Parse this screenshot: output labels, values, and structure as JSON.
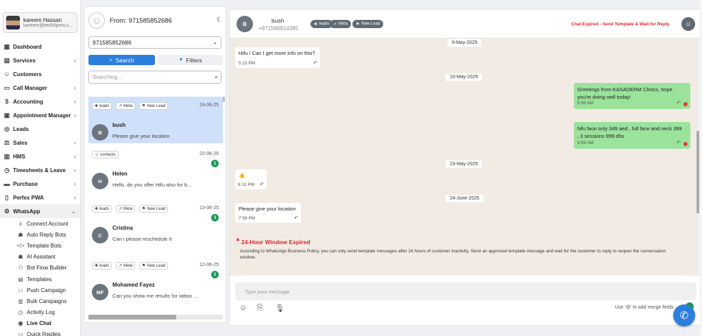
{
  "user": {
    "name": "kareem Hassan",
    "email": "kareem@tech9pros.c..."
  },
  "nav": [
    {
      "label": "Dashboard",
      "icon": "dashboard-icon",
      "glyph": "▦",
      "chevron": false
    },
    {
      "label": "Services",
      "icon": "services-icon",
      "glyph": "▤",
      "chevron": true
    },
    {
      "label": "Customers",
      "icon": "customers-icon",
      "glyph": "☺",
      "chevron": false
    },
    {
      "label": "Call Manager",
      "icon": "call-manager-icon",
      "glyph": "▭",
      "chevron": true
    },
    {
      "label": "Accounting",
      "icon": "accounting-icon",
      "glyph": "$",
      "chevron": true
    },
    {
      "label": "Appointment Manager",
      "icon": "appointment-icon",
      "glyph": "▣",
      "chevron": true
    },
    {
      "label": "Leads",
      "icon": "leads-icon",
      "glyph": "◎",
      "chevron": false
    },
    {
      "label": "Sales",
      "icon": "sales-icon",
      "glyph": "⚖",
      "chevron": true
    },
    {
      "label": "HMS",
      "icon": "hms-icon",
      "glyph": "▥",
      "chevron": true
    },
    {
      "label": "Timesheets & Leave",
      "icon": "timesheets-icon",
      "glyph": "◷",
      "chevron": true
    },
    {
      "label": "Purchase",
      "icon": "purchase-icon",
      "glyph": "▬",
      "chevron": true
    },
    {
      "label": "Perfex PWA",
      "icon": "pwa-icon",
      "glyph": "▯",
      "chevron": true
    },
    {
      "label": "WhatsApp",
      "icon": "whatsapp-icon",
      "glyph": "⚙",
      "chevron": true,
      "expanded": true
    }
  ],
  "subnav": [
    {
      "label": "Connect Account",
      "icon": "plug-icon",
      "glyph": "⏚"
    },
    {
      "label": "Auto Reply Bots",
      "icon": "robot-icon",
      "glyph": "☗"
    },
    {
      "label": "Template Bots",
      "icon": "code-icon",
      "glyph": "</>"
    },
    {
      "label": "AI Assistant",
      "icon": "ai-robot-icon",
      "glyph": "☗"
    },
    {
      "label": "Bot Flow Builder",
      "icon": "flow-icon",
      "glyph": "⚇"
    },
    {
      "label": "Templates",
      "icon": "templates-icon",
      "glyph": "▤"
    },
    {
      "label": "Push Campaign",
      "icon": "push-icon",
      "glyph": "▭"
    },
    {
      "label": "Bulk Campaigns",
      "icon": "bulk-icon",
      "glyph": "▥"
    },
    {
      "label": "Activity Log",
      "icon": "history-icon",
      "glyph": "◷"
    },
    {
      "label": "Live Chat",
      "icon": "chat-bubbles-icon",
      "glyph": "◉",
      "current": true
    },
    {
      "label": "Quick Replies",
      "icon": "quick-reply-icon",
      "glyph": "▭"
    }
  ],
  "contacts_panel": {
    "from_label": "From: 971585852686",
    "selected_number": "971585852686",
    "search_label": "Search",
    "filters_label": "Filters",
    "search_placeholder": "Searching..."
  },
  "chats": [
    {
      "tags": [
        "leads",
        "Meta",
        "New Lead"
      ],
      "date": "24-06-25",
      "initial": "B",
      "name": "bush",
      "message": "Please give your location",
      "unread": "",
      "selected": true
    },
    {
      "tags": [
        "contacts"
      ],
      "date": "22-06-25",
      "initial": "H",
      "name": "Helen",
      "message": "Hello, do you offer Hifu also for b...",
      "unread": "1",
      "selected": false
    },
    {
      "tags": [
        "leads",
        "Meta",
        "New Lead"
      ],
      "date": "13-06-25",
      "initial": "C",
      "name": "Cristina",
      "message": "Can i please reschedule it",
      "unread": "3",
      "selected": false
    },
    {
      "tags": [
        "leads",
        "Meta",
        "New Lead"
      ],
      "date": "12-06-25",
      "initial": "MF",
      "name": "Mohamed Fayez",
      "message": "Can you show me results for tattoo ...",
      "unread": "2",
      "selected": false
    }
  ],
  "conversation": {
    "contact_initial": "B",
    "contact_name": "bush",
    "contact_phone": "+971566914385",
    "header_tags": [
      "leads",
      "Meta",
      "New Lead"
    ],
    "expired_notice": "Chat Expired - Send Template & Wait for Reply",
    "dates": [
      "9-May-2025",
      "10-May-2025",
      "23-May-2025",
      "24-June-2025"
    ],
    "messages": [
      {
        "dir": "in",
        "text": "Hifu ! Can I get more info on this?",
        "time": "5:23 PM"
      },
      {
        "dir": "out",
        "lines": [
          "Greetings from KASADERM Clinics, hope",
          "you're doing well today!"
        ],
        "time": "9:58 AM"
      },
      {
        "dir": "out",
        "lines": [
          "hifu face only 349 aed , full face and neck 399",
          ", 3 sessions 999 dhs"
        ],
        "time": "9:59 AM"
      },
      {
        "dir": "in",
        "text": "👍",
        "time": "6:13 PM"
      },
      {
        "dir": "in",
        "text": "Please give your location",
        "time": "7:56 PM"
      }
    ],
    "warning_title": "24-Hour Window Expired",
    "warning_text": "According to WhatsApp Business Policy, you can only send template messages after 24 hours of customer inactivity. Send an approved template message and wait for the customer to reply to reopen the conversation window.",
    "composer_placeholder": "Type your message",
    "merge_hint": "Use '@' to add merge fields"
  },
  "colors": {
    "primary": "#2d7fde",
    "outgoing_bubble": "#9be29b",
    "chat_background": "#f1ebe4",
    "danger": "#d9252e",
    "badge": "#1f9a5a"
  }
}
